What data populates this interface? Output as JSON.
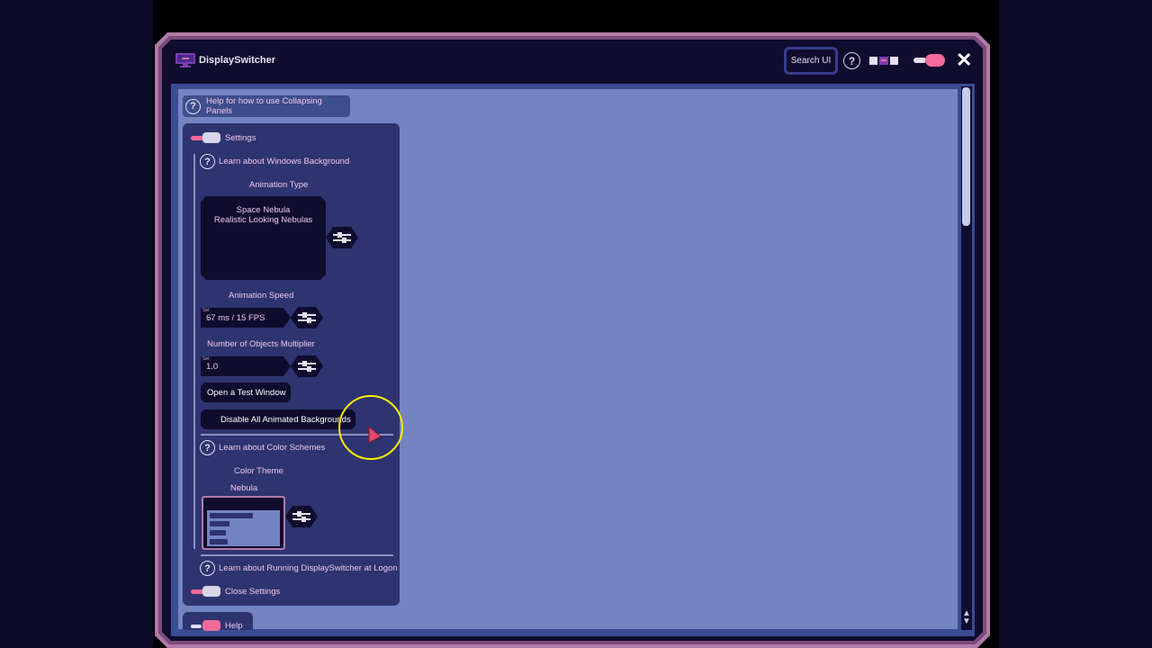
{
  "app": {
    "title": "DisplaySwitcher",
    "search_label": "Search UI",
    "help_glyph": "?",
    "close_glyph": "✕",
    "icons": [
      "app-monitor-icon",
      "help-icon",
      "monitor-layout-icon",
      "theme-toggle-icon",
      "close-icon"
    ]
  },
  "panels": {
    "help_panel_label": "Help for how to use Collapsing Panels",
    "settings_title": "Settings",
    "close_settings": "Close Settings",
    "help_title": "Help"
  },
  "settings": {
    "learn_windows_bg": "Learn about Windows Background",
    "animation_type_label": "Animation Type",
    "animation_type_line1": "Space Nebula",
    "animation_type_line2": "Realistic Looking Nebulas",
    "animation_speed_label": "Animation Speed",
    "animation_speed_value": "67 ms / 15 FPS",
    "objects_multiplier_label": "Number of Objects Multiplier",
    "objects_multiplier_value": "1.0",
    "field_mini_label": "Set",
    "test_window_button": "Open a Test Window",
    "disable_backgrounds_button": "Disable All Animated Backgrounds",
    "learn_color_schemes": "Learn about Color Schemes",
    "color_theme_label": "Color Theme",
    "color_theme_value": "Nebula",
    "learn_logon": "Learn about Running DisplaySwitcher at Logon"
  },
  "colors": {
    "accent_pink": "#f06a9a",
    "frame_outer": "#b07aa8",
    "content_bg": "#7484c2",
    "panel_bg": "#2e3470",
    "dark": "#0f0c2e",
    "cursor_highlight": "#ffee00"
  }
}
